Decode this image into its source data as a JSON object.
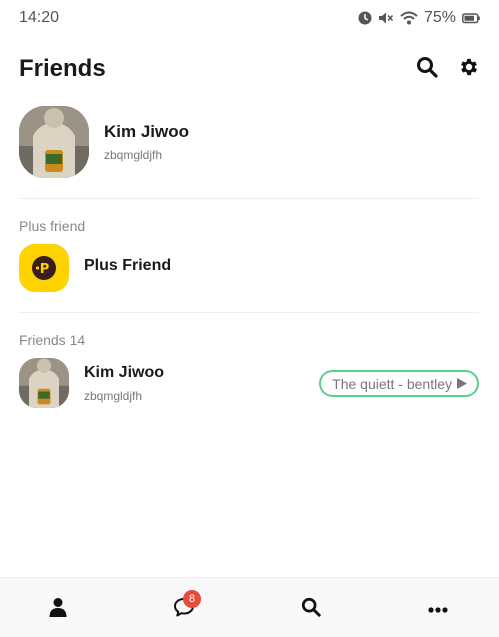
{
  "status_bar": {
    "time": "14:20",
    "battery": "75%",
    "icons": [
      "alarm-icon",
      "mute-icon",
      "wifi-icon",
      "battery-icon"
    ]
  },
  "header": {
    "title": "Friends",
    "actions": [
      "search-icon",
      "gear-icon"
    ]
  },
  "profile": {
    "name": "Kim Jiwoo",
    "status": "zbqmgldjfh"
  },
  "plus_section": {
    "label": "Plus friend",
    "item_name": "Plus Friend",
    "icon_color": "#fed300"
  },
  "friends_section": {
    "label": "Friends 14",
    "items": [
      {
        "name": "Kim Jiwoo",
        "status": "zbqmgldjfh",
        "music": "The quiett - bentley"
      }
    ]
  },
  "bottom_nav": {
    "items": [
      "person-icon",
      "chat-icon",
      "search-icon",
      "more-icon"
    ],
    "chat_badge": "8"
  },
  "colors": {
    "accent_yellow": "#fed300",
    "music_border": "#58d08e",
    "badge_red": "#e64b3b"
  }
}
